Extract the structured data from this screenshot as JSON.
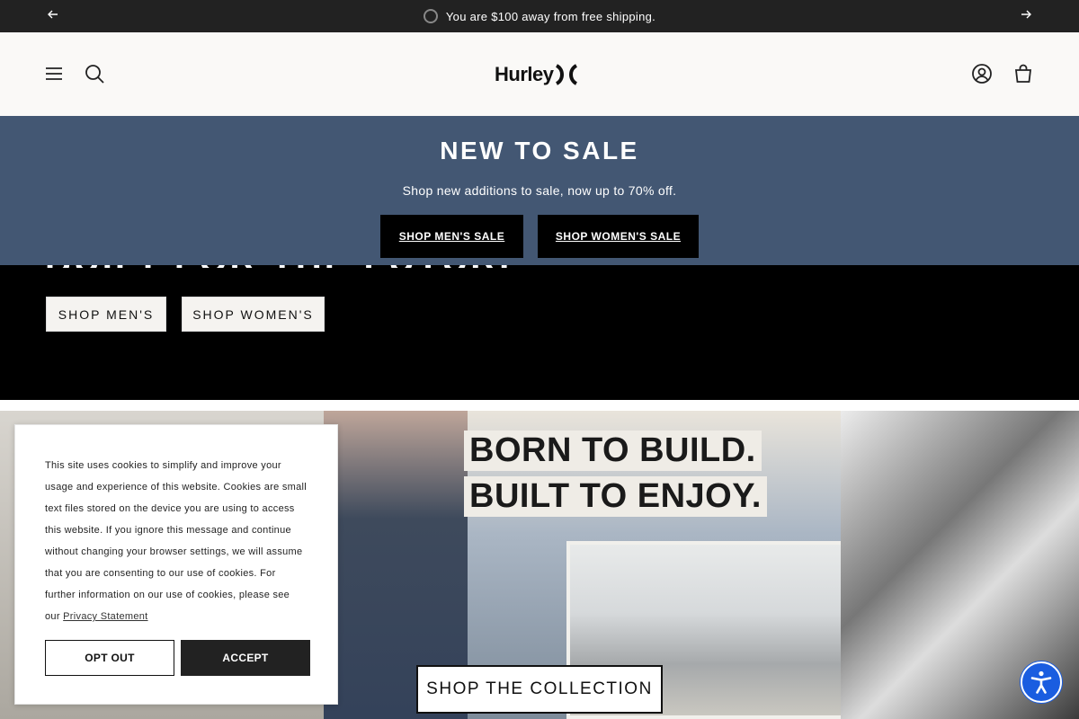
{
  "announcement": {
    "text": "You are $100 away from free shipping.",
    "prev_icon": "arrow-left-icon",
    "next_icon": "arrow-right-icon"
  },
  "header": {
    "logo_text": "Hurley",
    "icons": [
      "menu-icon",
      "search-icon",
      "account-icon",
      "cart-icon"
    ]
  },
  "sale_banner": {
    "title": "NEW TO SALE",
    "subtitle": "Shop new additions to sale, now up to 70% off.",
    "buttons": [
      "SHOP MEN'S SALE",
      "SHOP WOMEN'S SALE"
    ],
    "background_color": "#435773"
  },
  "hero": {
    "title_partial": "BUILT FOR THE FUTURE",
    "buttons": [
      "SHOP MEN'S",
      "SHOP WOMEN'S"
    ]
  },
  "collection": {
    "headline_lines": [
      "BORN TO BUILD.",
      "BUILT TO ENJOY."
    ],
    "cta": "SHOP THE COLLECTION"
  },
  "cookie_banner": {
    "text": "This site uses cookies to simplify and improve your usage and experience of this website. Cookies are small text files stored on the device you are using to access this website. If you ignore this message and continue without changing your browser settings, we will assume that you are consenting to our use of cookies. For further information on our use of cookies, please see our",
    "link": "Privacy Statement",
    "opt_out": "OPT OUT",
    "accept": "ACCEPT"
  },
  "accessibility": {
    "icon": "accessibility-icon",
    "color": "#1a5de0"
  }
}
